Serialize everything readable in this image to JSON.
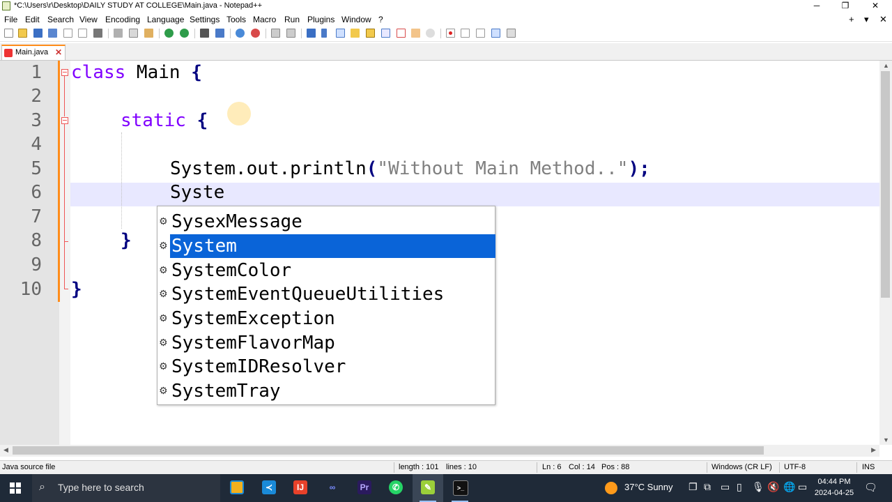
{
  "window": {
    "title": "*C:\\Users\\r\\Desktop\\DAILY STUDY AT COLLEGE\\Main.java - Notepad++",
    "minimize": "─",
    "restore": "❐",
    "close": "✕"
  },
  "menu": {
    "items": [
      "File",
      "Edit",
      "Search",
      "View",
      "Encoding",
      "Language",
      "Settings",
      "Tools",
      "Macro",
      "Run",
      "Plugins",
      "Window",
      "?"
    ],
    "add": "+",
    "dropdown": "▾",
    "close": "✕"
  },
  "tabs": [
    {
      "label": "Main.java",
      "close": "✕"
    }
  ],
  "editor": {
    "line_numbers": [
      "1",
      "2",
      "3",
      "4",
      "5",
      "6",
      "7",
      "8",
      "9",
      "10"
    ],
    "lines": {
      "l1_kw": "class",
      "l1_rest": " Main ",
      "l1_brace": "{",
      "l3_kw": "static",
      "l3_brace": "{",
      "l5_a": "System.out.println",
      "l5_paren_open": "(",
      "l5_str": "\"Without Main Method..\"",
      "l5_paren_close": ");",
      "l6": "Syste",
      "l8_brace": "}",
      "l10_brace": "}"
    }
  },
  "autocomplete": {
    "icon": "⚙",
    "items": [
      "SysexMessage",
      "System",
      "SystemColor",
      "SystemEventQueueUtilities",
      "SystemException",
      "SystemFlavorMap",
      "SystemIDResolver",
      "SystemTray"
    ],
    "selected_index": 1
  },
  "status": {
    "file_type": "Java source file",
    "length": "length : 101",
    "lines": "lines : 10",
    "ln": "Ln : 6",
    "col": "Col : 14",
    "pos": "Pos : 88",
    "eol": "Windows (CR LF)",
    "encoding": "UTF-8",
    "mode": "INS"
  },
  "taskbar": {
    "search_placeholder": "Type here to search",
    "weather": "37°C  Sunny",
    "time": "04:44 PM",
    "date": "2024-04-25"
  }
}
